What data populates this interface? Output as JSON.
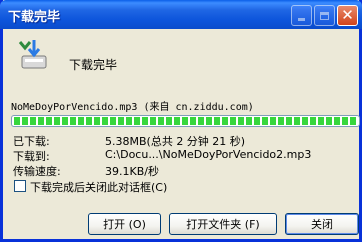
{
  "window": {
    "title": "下载完毕"
  },
  "header": {
    "label": "下载完毕"
  },
  "file": {
    "line": "NoMeDoyPorVencido.mp3 (来自 cn.ziddu.com)",
    "progress_percent": 100
  },
  "info": {
    "downloaded_label": "已下载:",
    "downloaded_value": "5.38MB(总共 2 分钟 21 秒)",
    "saved_to_label": "下载到:",
    "saved_to_value": "C:\\Docu...\\NoMeDoyPorVencido2.mp3",
    "speed_label": "传输速度:",
    "speed_value": "39.1KB/秒"
  },
  "options": {
    "close_on_complete_label": "下载完成后关闭此对话框(C)",
    "close_on_complete_checked": false
  },
  "buttons": {
    "open": "打开 (O)",
    "open_folder": "打开文件夹 (F)",
    "close": "关闭"
  },
  "colors": {
    "title_bar": "#0C54DB",
    "progress_fill": "#37D63C",
    "dialog_bg": "#ECE9D8"
  }
}
